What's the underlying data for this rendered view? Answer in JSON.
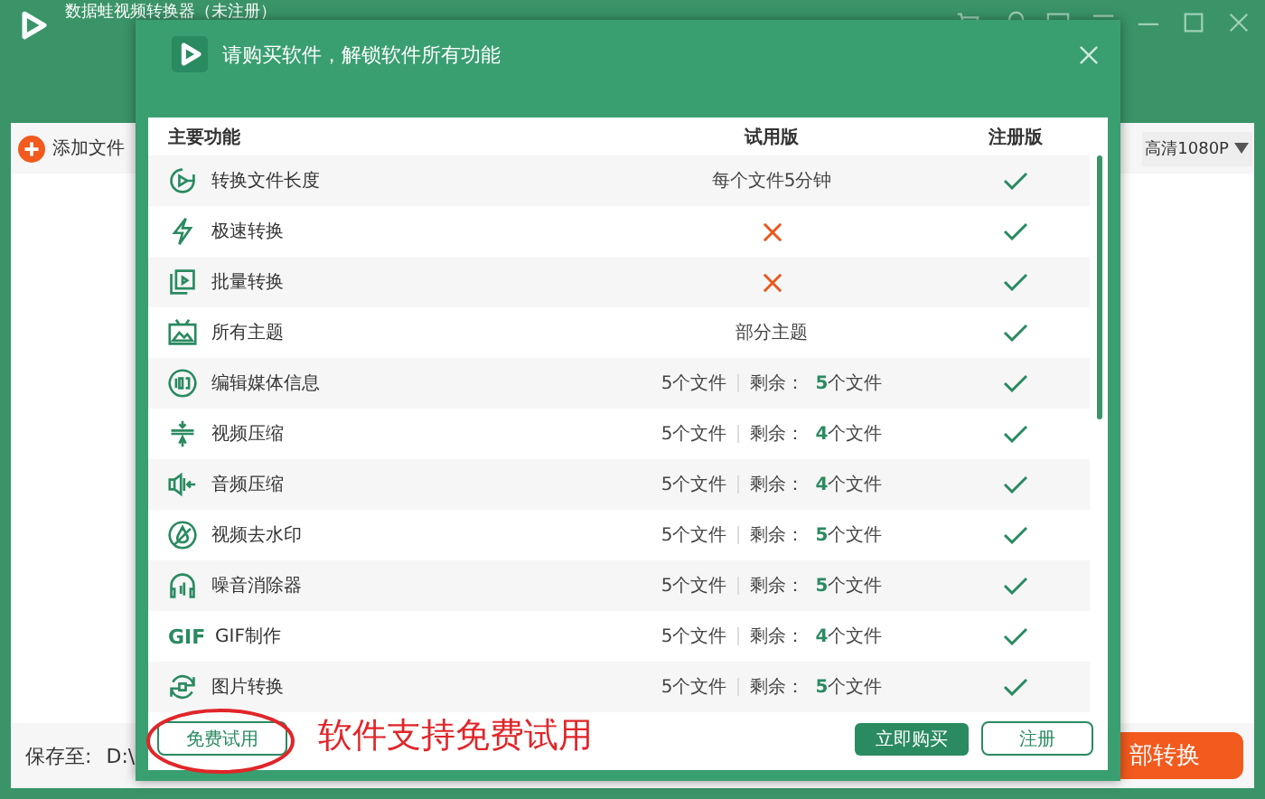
{
  "app": {
    "title": "数据蛙视频转换器（未注册）",
    "add_file": "添加文件",
    "quality": "高清1080P",
    "save_label": "保存至:",
    "save_path": "D:\\",
    "convert_all": "部转换"
  },
  "dialog": {
    "title": "请购买软件，解锁软件所有功能",
    "columns": [
      "主要功能",
      "试用版",
      "注册版"
    ],
    "rows": [
      {
        "name": "转换文件长度",
        "trial": {
          "kind": "text",
          "text": "每个文件5分钟"
        },
        "registered": true
      },
      {
        "name": "极速转换",
        "trial": {
          "kind": "cross"
        },
        "registered": true
      },
      {
        "name": "批量转换",
        "trial": {
          "kind": "cross"
        },
        "registered": true
      },
      {
        "name": "所有主题",
        "trial": {
          "kind": "text",
          "text": "部分主题"
        },
        "registered": true
      },
      {
        "name": "编辑媒体信息",
        "trial": {
          "kind": "quota",
          "total": "5个文件",
          "remain_label": "剩余：",
          "remain": "**5**个文件"
        },
        "registered": true
      },
      {
        "name": "视频压缩",
        "trial": {
          "kind": "quota",
          "total": "5个文件",
          "remain_label": "剩余：",
          "remain": "**4**个文件"
        },
        "registered": true
      },
      {
        "name": "音频压缩",
        "trial": {
          "kind": "quota",
          "total": "5个文件",
          "remain_label": "剩余：",
          "remain": "**4**个文件"
        },
        "registered": true
      },
      {
        "name": "视频去水印",
        "trial": {
          "kind": "quota",
          "total": "5个文件",
          "remain_label": "剩余：",
          "remain": "**5**个文件"
        },
        "registered": true
      },
      {
        "name": "噪音消除器",
        "trial": {
          "kind": "quota",
          "total": "5个文件",
          "remain_label": "剩余：",
          "remain": "**5**个文件"
        },
        "registered": true
      },
      {
        "name": "GIF制作",
        "icon_text": "GIF",
        "trial": {
          "kind": "quota",
          "total": "5个文件",
          "remain_label": "剩余：",
          "remain": "**4**个文件"
        },
        "registered": true
      },
      {
        "name": "图片转换",
        "trial": {
          "kind": "quota",
          "total": "5个文件",
          "remain_label": "剩余：",
          "remain": "**5**个文件"
        },
        "registered": true
      }
    ],
    "free_trial": "免费试用",
    "buy_now": "立即购买",
    "register": "注册"
  },
  "annotation": "软件支持免费试用"
}
